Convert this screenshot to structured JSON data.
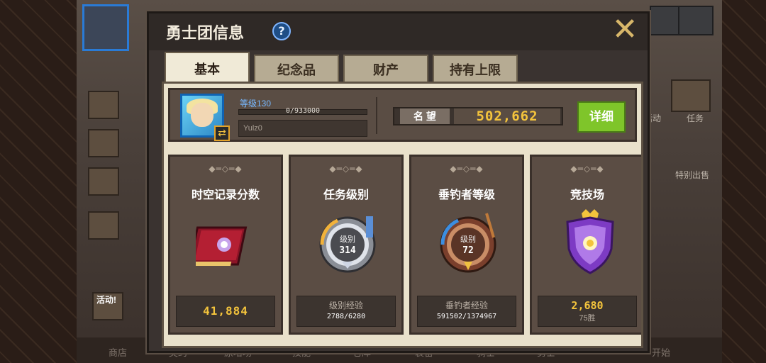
{
  "background": {
    "nav_items": [
      "商店",
      "契约",
      "原培场",
      "技能",
      "仓库",
      "装备",
      "骑士",
      "勇士",
      "开始"
    ],
    "side_labels": [
      "活动",
      "任务",
      "特别出售"
    ],
    "badge": "活动!"
  },
  "dialog": {
    "title": "勇士团信息",
    "help": "?",
    "close": "✕",
    "tabs": [
      {
        "label": "基本"
      },
      {
        "label": "纪念品"
      },
      {
        "label": "财产"
      },
      {
        "label": "持有上限"
      }
    ]
  },
  "profile": {
    "level": "等级130",
    "exp_text": "0/933000",
    "exp_fraction": 0,
    "name": "Yulz0",
    "fame_label": "名 望",
    "fame_value": "502,662",
    "detail_button": "详细"
  },
  "cards": [
    {
      "title": "时空记录分数",
      "value": "41,884"
    },
    {
      "title": "任务级别",
      "badge_label": "级别",
      "badge_value": "314",
      "sub_label": "级别经验",
      "sub_value": "2788/6280"
    },
    {
      "title": "垂钓者等级",
      "badge_label": "级别",
      "badge_value": "72",
      "sub_label": "垂钓者经验",
      "sub_value": "591502/1374967"
    },
    {
      "title": "竞技场",
      "value": "2,680",
      "wins": "75胜"
    }
  ],
  "colors": {
    "accent_gold": "#f4c43c",
    "detail_green": "#7fc52a",
    "level_blue": "#77b8ff"
  }
}
